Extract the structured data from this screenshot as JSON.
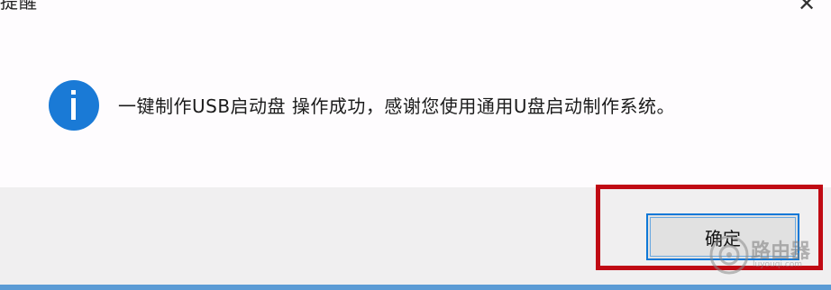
{
  "dialog": {
    "title": "提醒",
    "close_glyph": "✕"
  },
  "message": {
    "text": "一键制作USB启动盘 操作成功，感谢您使用通用U盘启动制作系统。",
    "icon": "info-icon"
  },
  "buttons": {
    "ok_label": "确定"
  },
  "watermark": {
    "title": "路由器",
    "subtitle": "luyouqi.com"
  },
  "colors": {
    "icon_blue": "#1a7ad6",
    "highlight_red": "#c00a14",
    "button_border": "#0f78d7",
    "footer_bg": "#f0eff0"
  }
}
